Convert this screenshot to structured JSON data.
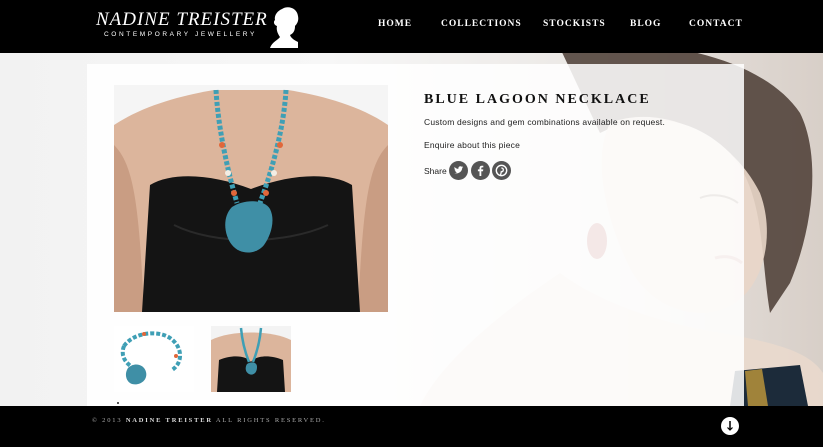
{
  "header": {
    "logo_name": "NADINE TREISTER",
    "logo_sub": "CONTEMPORARY JEWELLERY",
    "nav": [
      "HOME",
      "COLLECTIONS",
      "STOCKISTS",
      "BLOG",
      "CONTACT"
    ]
  },
  "product": {
    "title": "BLUE LAGOON NECKLACE",
    "description": "Custom designs and gem combinations available on request.",
    "enquire": "Enquire about this piece",
    "share_label": "Share",
    "share_icons": [
      "twitter-icon",
      "facebook-icon",
      "pinterest-icon"
    ]
  },
  "footer": {
    "copyright_prefix": "© 2013",
    "copyright_brand": "NADINE TREISTER",
    "copyright_suffix": "ALL RIGHTS RESERVED."
  },
  "colors": {
    "header_bg": "#000000",
    "footer_bg": "#000000",
    "necklace_blue": "#3f8fa6",
    "bead_orange": "#e0673a"
  }
}
